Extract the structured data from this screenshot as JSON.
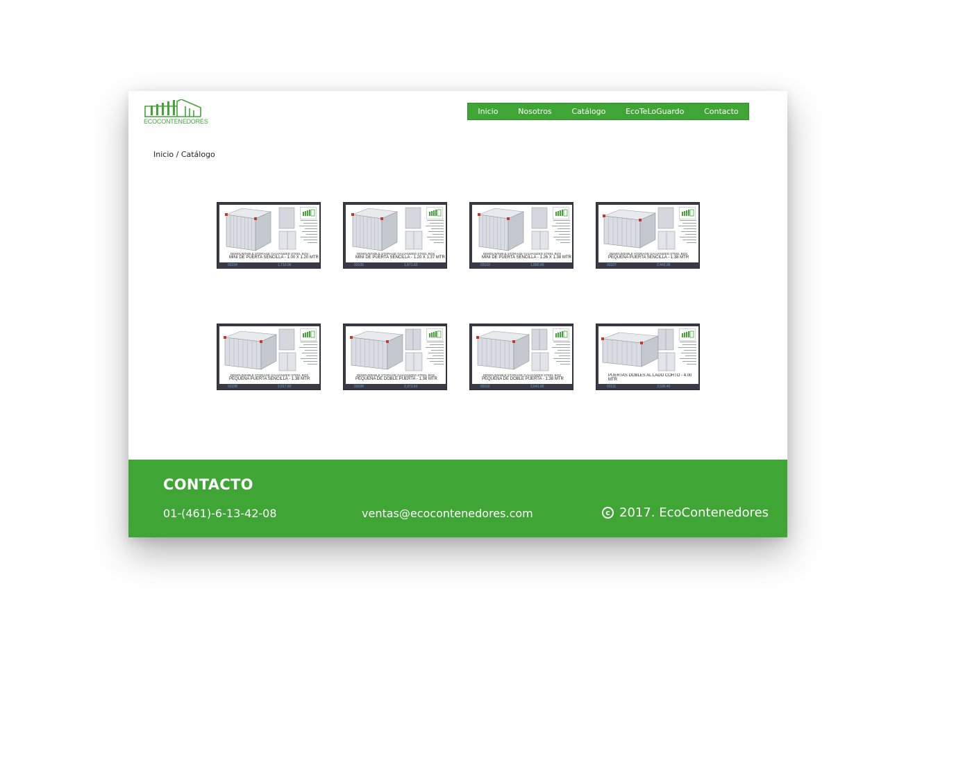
{
  "header": {
    "logo_text": "ECOCONTENEDORES",
    "nav": [
      "Inicio",
      "Nosotros",
      "Catálogo",
      "EcoTeLoGuardo",
      "Contacto"
    ]
  },
  "breadcrumb": {
    "home": "Inicio",
    "separator": " / ",
    "current": "Catálogo"
  },
  "catalog": {
    "items": [
      {
        "subtitle": "DEMOUNTABLE STORAGE GALVANIZED STEEL BOX",
        "title": "MINI DE PUERTA SENCILLA - 1.00 X 1.20 MTR",
        "code": "03104",
        "price": "1,710.00",
        "variant": "mini"
      },
      {
        "subtitle": "DEMOUNTABLE STORAGE GALVANIZED STEEL BOX",
        "title": "MINI DE PUERTA SENCILLA - 1.20 X 1.37 MTR",
        "code": "03105",
        "price": "1,871.60",
        "variant": "mini"
      },
      {
        "subtitle": "DEMOUNTABLE STORAGE GALVANIZED STEEL BOX",
        "title": "MINI DE PUERTA SENCILLA - 1.26 X 1.38 MTR",
        "code": "03103",
        "price": "1,880.00",
        "variant": "mini"
      },
      {
        "subtitle": "DEMOUNTABLE STORAGE GALVANIZED STEEL BOX",
        "title": "PEQUEÑA PUERTA SENCILLA - 1.38 MTR",
        "code": "03107",
        "price": "2,443.00",
        "variant": "small"
      },
      {
        "subtitle": "DEMOUNTABLE STORAGE GALVANIZED STEEL BOX",
        "title": "PEQUEÑA PUERTA SENCILLA - 1.38 MTR",
        "code": "03108",
        "price": "2,017.60",
        "variant": "small"
      },
      {
        "subtitle": "DEMOUNTABLE STORAGE GALVANIZED STEEL BOX",
        "title": "PEQUEÑA DE DOBLE PUERTA - 1.38 MTR",
        "code": "03109",
        "price": "2,373.60",
        "variant": "double"
      },
      {
        "subtitle": "DEMOUNTABLE STORAGE GALVANIZED STEEL BOX",
        "title": "PEQUEÑA DE DOBLE PUERTA - 1.38 MTR",
        "code": "03110",
        "price": "2,641.60",
        "variant": "double"
      },
      {
        "subtitle": "",
        "title": "PUERTAS DOBLES AL LADO CORTO - 4.00 MTR",
        "code": "03111",
        "price": "3,590.40",
        "variant": "long"
      }
    ]
  },
  "footer": {
    "title": "CONTACTO",
    "phone": "01-(461)-6-13-42-08",
    "email": "ventas@ecocontenedores.com",
    "copyright": "2017. EcoContenedores",
    "copyright_symbol": "c"
  },
  "colors": {
    "brand_green": "#3fa535",
    "card_frame": "#3a3a46"
  }
}
